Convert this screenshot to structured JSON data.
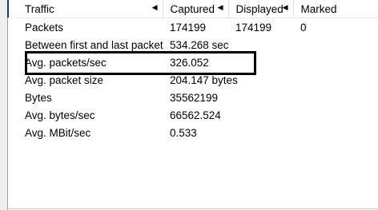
{
  "columns": [
    {
      "label": "Traffic"
    },
    {
      "label": "Captured"
    },
    {
      "label": "Displayed"
    },
    {
      "label": "Marked"
    }
  ],
  "rows": [
    {
      "traffic": "Packets",
      "captured": "174199",
      "displayed": "174199",
      "marked": "0"
    },
    {
      "traffic": "Between first and last packet",
      "captured": "534.268 sec",
      "displayed": "",
      "marked": ""
    },
    {
      "traffic": "Avg. packets/sec",
      "captured": "326.052",
      "displayed": "",
      "marked": ""
    },
    {
      "traffic": "Avg. packet size",
      "captured": "204.147 bytes",
      "displayed": "",
      "marked": ""
    },
    {
      "traffic": "Bytes",
      "captured": "35562199",
      "displayed": "",
      "marked": ""
    },
    {
      "traffic": "Avg. bytes/sec",
      "captured": "66562.524",
      "displayed": "",
      "marked": ""
    },
    {
      "traffic": "Avg. MBit/sec",
      "captured": "0.533",
      "displayed": "",
      "marked": ""
    }
  ],
  "highlighted_row": "Between first and last packet",
  "colors": {
    "highlight_border": "#000000",
    "header_bg": "#ffffff"
  }
}
